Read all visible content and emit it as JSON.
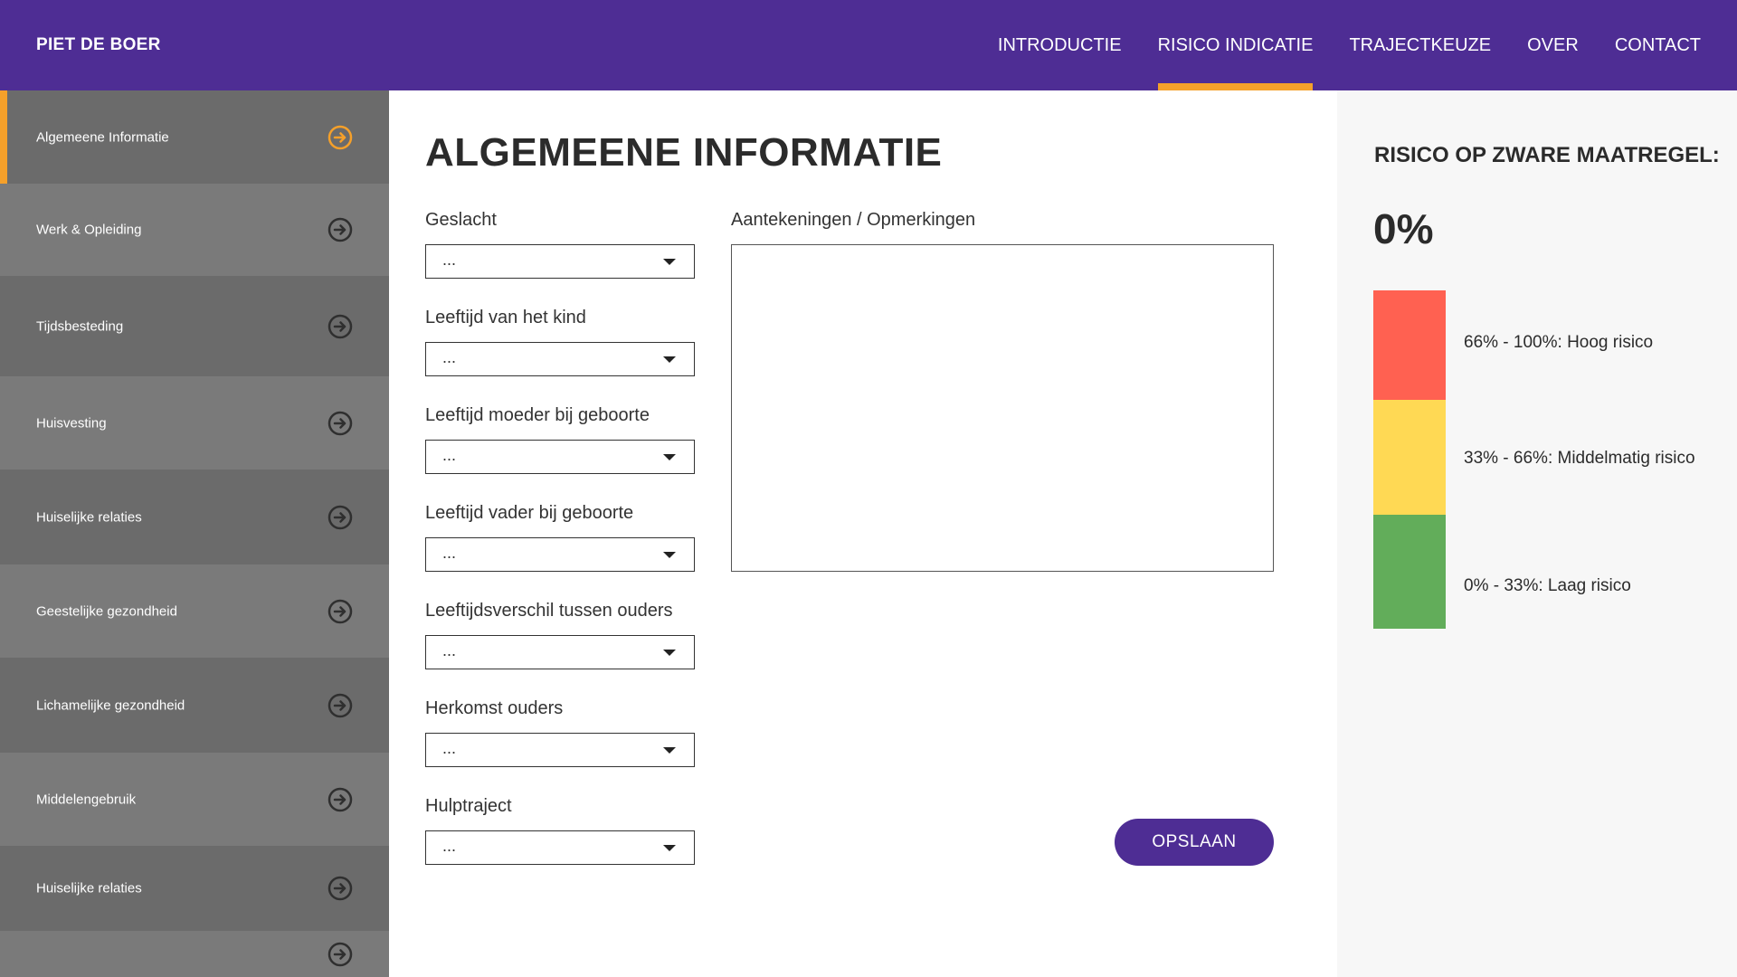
{
  "header": {
    "brand": "PIET DE BOER",
    "nav": [
      {
        "label": "INTRODUCTIE",
        "active": false
      },
      {
        "label": "RISICO INDICATIE",
        "active": true
      },
      {
        "label": "TRAJECTKEUZE",
        "active": false
      },
      {
        "label": "OVER",
        "active": false
      },
      {
        "label": "CONTACT",
        "active": false
      }
    ]
  },
  "sidebar": {
    "items": [
      {
        "label": "Algemeene Informatie",
        "active": true,
        "bg": "#6b6b6b"
      },
      {
        "label": "Werk & Opleiding",
        "active": false,
        "bg": "#7a7a7a"
      },
      {
        "label": "Tijdsbesteding",
        "active": false,
        "bg": "#6b6b6b"
      },
      {
        "label": "Huisvesting",
        "active": false,
        "bg": "#7a7a7a"
      },
      {
        "label": "Huiselijke relaties",
        "active": false,
        "bg": "#6b6b6b"
      },
      {
        "label": "Geestelijke gezondheid",
        "active": false,
        "bg": "#7a7a7a"
      },
      {
        "label": "Lichamelijke gezondheid",
        "active": false,
        "bg": "#6b6b6b"
      },
      {
        "label": "Middelengebruik",
        "active": false,
        "bg": "#7a7a7a"
      },
      {
        "label": "Huiselijke relaties",
        "active": false,
        "bg": "#6b6b6b"
      },
      {
        "label": "",
        "active": false,
        "bg": "#7a7a7a"
      }
    ],
    "accent_color": "#f5a02a"
  },
  "main": {
    "title": "ALGEMEENE INFORMATIE",
    "fields": [
      {
        "label": "Geslacht",
        "value": "..."
      },
      {
        "label": "Leeftijd van het kind",
        "value": "..."
      },
      {
        "label": "Leeftijd moeder bij geboorte",
        "value": "..."
      },
      {
        "label": "Leeftijd vader bij geboorte",
        "value": "..."
      },
      {
        "label": "Leeftijdsverschil tussen ouders",
        "value": "..."
      },
      {
        "label": "Herkomst ouders",
        "value": "..."
      },
      {
        "label": "Hulptraject",
        "value": "..."
      }
    ],
    "notes_label": "Aantekeningen / Opmerkingen",
    "notes_value": "",
    "save_label": "OPSLAAN"
  },
  "panel": {
    "title": "RISICO OP ZWARE MAATREGEL:",
    "value": "0%",
    "legend": [
      {
        "label": "66% - 100%: Hoog risico",
        "color": "#ff6151"
      },
      {
        "label": "33% - 66%: Middelmatig risico",
        "color": "#ffd954"
      },
      {
        "label": "0% - 33%: Laag risico",
        "color": "#62ad5a"
      }
    ]
  },
  "colors": {
    "brand_purple": "#4e2d94",
    "accent_orange": "#f5a02a"
  }
}
